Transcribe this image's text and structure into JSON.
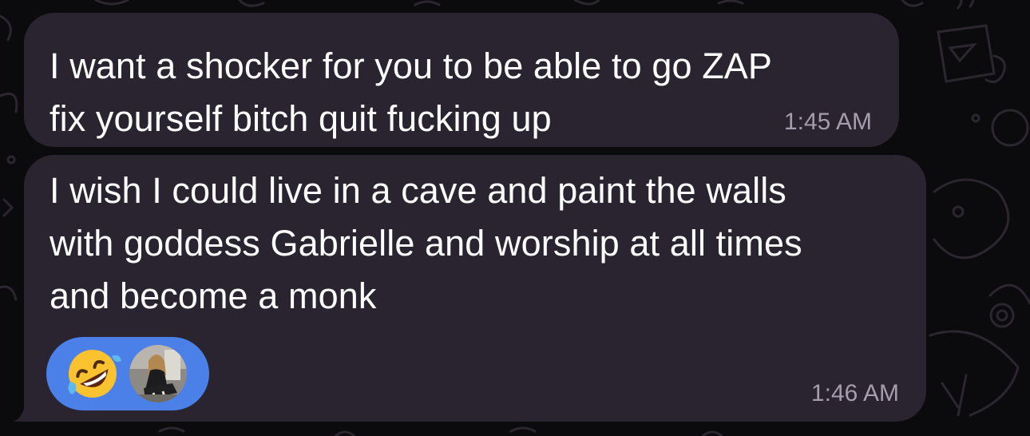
{
  "messages": [
    {
      "text_lines": [
        "I want a shocker for you to be able to go ZAP",
        "fix yourself bitch quit fucking up"
      ],
      "time": "1:45 AM"
    },
    {
      "text_lines": [
        "I wish I could live in a cave and paint the walls",
        "with goddess Gabrielle and worship at all times",
        "and become a monk"
      ],
      "time": "1:46 AM",
      "reactions": {
        "emoji_icon": "rolling-on-floor-laughing-icon",
        "avatar_icon": "reactor-avatar"
      }
    }
  ],
  "colors": {
    "background": "#0b0a0c",
    "bubble": "#2a2330",
    "reaction_pill": "#4a80e8",
    "time_text": "#a59dae"
  }
}
